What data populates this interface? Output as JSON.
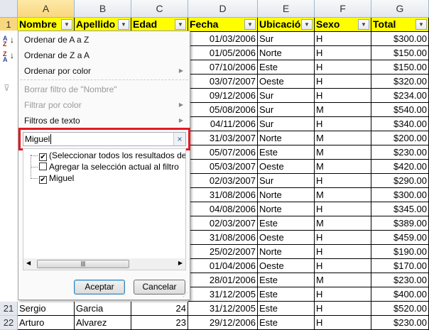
{
  "columns": [
    "A",
    "B",
    "C",
    "D",
    "E",
    "F",
    "G"
  ],
  "headers": [
    "Nombre",
    "Apellido",
    "Edad",
    "Fecha",
    "Ubicación",
    "Sexo",
    "Total"
  ],
  "row_numbers": [
    "1",
    "21",
    "22"
  ],
  "visible_rows": [
    {
      "num": "21",
      "nombre": "Sergio",
      "apellido": "Garcia",
      "edad": "24"
    },
    {
      "num": "22",
      "nombre": "Arturo",
      "apellido": "Alvarez",
      "edad": "23"
    }
  ],
  "right_rows": [
    [
      "01/03/2006",
      "Sur",
      "H",
      "$300.00"
    ],
    [
      "01/05/2006",
      "Norte",
      "H",
      "$150.00"
    ],
    [
      "07/10/2006",
      "Este",
      "H",
      "$150.00"
    ],
    [
      "03/07/2007",
      "Oeste",
      "H",
      "$320.00"
    ],
    [
      "09/12/2006",
      "Sur",
      "H",
      "$234.00"
    ],
    [
      "05/08/2006",
      "Sur",
      "M",
      "$540.00"
    ],
    [
      "04/11/2006",
      "Sur",
      "H",
      "$340.00"
    ],
    [
      "31/03/2007",
      "Norte",
      "M",
      "$200.00"
    ],
    [
      "05/07/2006",
      "Este",
      "M",
      "$230.00"
    ],
    [
      "05/03/2007",
      "Oeste",
      "M",
      "$420.00"
    ],
    [
      "02/03/2007",
      "Sur",
      "H",
      "$290.00"
    ],
    [
      "31/08/2006",
      "Norte",
      "M",
      "$300.00"
    ],
    [
      "04/08/2006",
      "Norte",
      "H",
      "$345.00"
    ],
    [
      "02/03/2007",
      "Este",
      "M",
      "$389.00"
    ],
    [
      "31/08/2006",
      "Oeste",
      "H",
      "$459.00"
    ],
    [
      "25/02/2007",
      "Norte",
      "H",
      "$190.00"
    ],
    [
      "01/04/2006",
      "Oeste",
      "H",
      "$170.00"
    ],
    [
      "28/01/2006",
      "Este",
      "M",
      "$230.00"
    ],
    [
      "31/12/2005",
      "Este",
      "H",
      "$400.00"
    ],
    [
      "31/12/2005",
      "Este",
      "H",
      "$520.00"
    ],
    [
      "29/12/2006",
      "Este",
      "H",
      "$230.00"
    ]
  ],
  "menu": {
    "sort_az": "Ordenar de A a Z",
    "sort_za": "Ordenar de Z a A",
    "sort_color": "Ordenar por color",
    "clear_filter": "Borrar filtro de \"Nombre\"",
    "filter_color": "Filtrar por color",
    "text_filters": "Filtros de texto",
    "search_value": "Miguel",
    "clear_icon": "×",
    "list": [
      {
        "label": "(Seleccionar todos los resultados de búsqueda)",
        "checked": true
      },
      {
        "label": "Agregar la selección actual al filtro",
        "checked": false
      },
      {
        "label": "Miguel",
        "checked": true
      }
    ],
    "ok": "Aceptar",
    "cancel": "Cancelar"
  },
  "colors": {
    "header_fill": "#ffff00",
    "highlight": "#e31b23"
  }
}
